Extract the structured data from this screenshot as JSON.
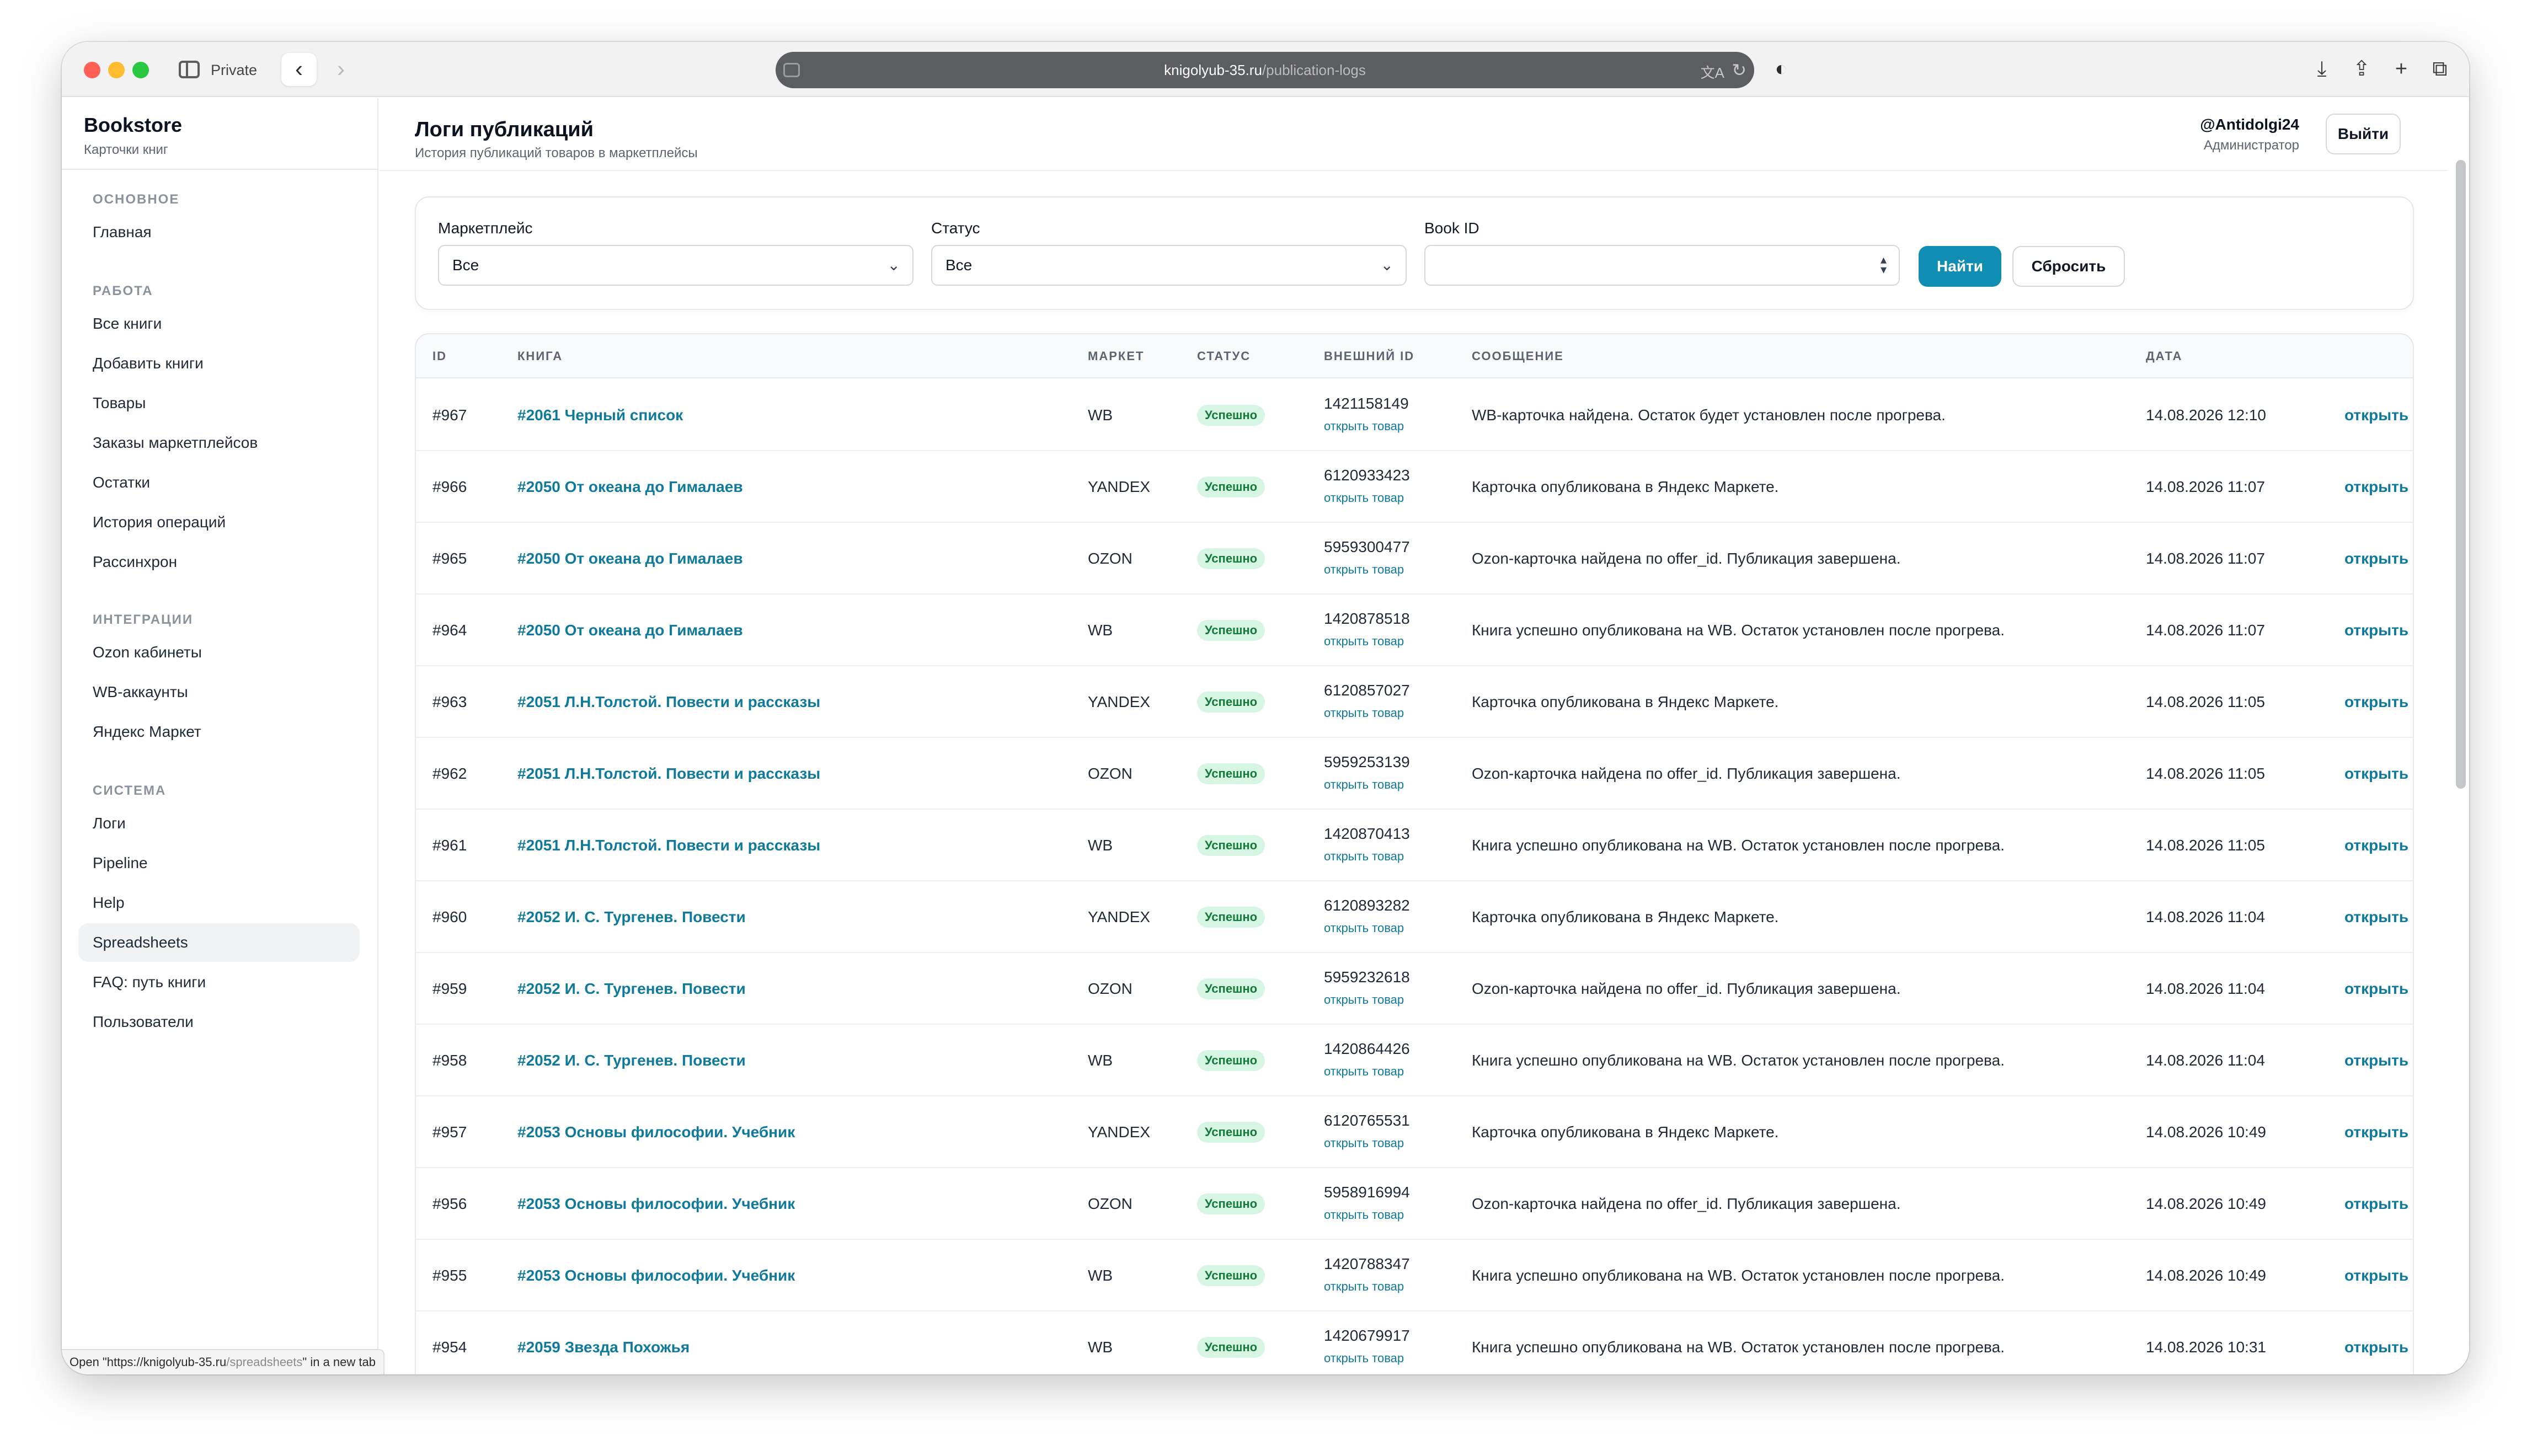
{
  "browser": {
    "private_label": "Private",
    "url_host": "knigolyub-35.ru",
    "url_path": "/publication-logs",
    "status_tip_prefix": "Open \"https://knigolyub-35.ru",
    "status_tip_path": "/spreadsheets",
    "status_tip_suffix": "\" in a new tab"
  },
  "sidebar": {
    "brand": "Bookstore",
    "brand_sub": "Карточки книг",
    "sections": [
      {
        "label": "ОСНОВНОЕ",
        "items": [
          "Главная"
        ]
      },
      {
        "label": "РАБОТА",
        "items": [
          "Все книги",
          "Добавить книги",
          "Товары",
          "Заказы маркетплейсов",
          "Остатки",
          "История операций",
          "Рассинхрон"
        ]
      },
      {
        "label": "ИНТЕГРАЦИИ",
        "items": [
          "Ozon кабинеты",
          "WB-аккаунты",
          "Яндекс Маркет"
        ]
      },
      {
        "label": "СИСТЕМА",
        "items": [
          "Логи",
          "Pipeline",
          "Help",
          "Spreadsheets",
          "FAQ: путь книги",
          "Пользователи"
        ]
      }
    ],
    "active_item": "Spreadsheets"
  },
  "header": {
    "title": "Логи публикаций",
    "subtitle": "История публикаций товаров в маркетплейсы",
    "user": "@Antidolgi24",
    "role": "Администратор",
    "logout": "Выйти"
  },
  "filters": {
    "marketplace_label": "Маркетплейс",
    "marketplace_value": "Все",
    "status_label": "Статус",
    "status_value": "Все",
    "book_id_label": "Book ID",
    "book_id_value": "",
    "find": "Найти",
    "reset": "Сбросить"
  },
  "table": {
    "columns": [
      "ID",
      "КНИГА",
      "МАРКЕТ",
      "СТАТУС",
      "ВНЕШНИЙ ID",
      "СООБЩЕНИЕ",
      "ДАТА"
    ],
    "ext_link_label": "открыть товар",
    "open_label": "открыть",
    "rows": [
      {
        "id": "#967",
        "book": "#2061 Черный список",
        "market": "WB",
        "status": "Успешно",
        "ext_id": "1421158149",
        "message": "WB-карточка найдена. Остаток будет установлен после прогрева.",
        "date": "14.08.2026 12:10"
      },
      {
        "id": "#966",
        "book": "#2050 От океана до Гималаев",
        "market": "YANDEX",
        "status": "Успешно",
        "ext_id": "6120933423",
        "message": "Карточка опубликована в Яндекс Маркете.",
        "date": "14.08.2026 11:07"
      },
      {
        "id": "#965",
        "book": "#2050 От океана до Гималаев",
        "market": "OZON",
        "status": "Успешно",
        "ext_id": "5959300477",
        "message": "Ozon-карточка найдена по offer_id. Публикация завершена.",
        "date": "14.08.2026 11:07"
      },
      {
        "id": "#964",
        "book": "#2050 От океана до Гималаев",
        "market": "WB",
        "status": "Успешно",
        "ext_id": "1420878518",
        "message": "Книга успешно опубликована на WB. Остаток установлен после прогрева.",
        "date": "14.08.2026 11:07"
      },
      {
        "id": "#963",
        "book": "#2051 Л.Н.Толстой. Повести и рассказы",
        "market": "YANDEX",
        "status": "Успешно",
        "ext_id": "6120857027",
        "message": "Карточка опубликована в Яндекс Маркете.",
        "date": "14.08.2026 11:05"
      },
      {
        "id": "#962",
        "book": "#2051 Л.Н.Толстой. Повести и рассказы",
        "market": "OZON",
        "status": "Успешно",
        "ext_id": "5959253139",
        "message": "Ozon-карточка найдена по offer_id. Публикация завершена.",
        "date": "14.08.2026 11:05"
      },
      {
        "id": "#961",
        "book": "#2051 Л.Н.Толстой. Повести и рассказы",
        "market": "WB",
        "status": "Успешно",
        "ext_id": "1420870413",
        "message": "Книга успешно опубликована на WB. Остаток установлен после прогрева.",
        "date": "14.08.2026 11:05"
      },
      {
        "id": "#960",
        "book": "#2052 И. С. Тургенев. Повести",
        "market": "YANDEX",
        "status": "Успешно",
        "ext_id": "6120893282",
        "message": "Карточка опубликована в Яндекс Маркете.",
        "date": "14.08.2026 11:04"
      },
      {
        "id": "#959",
        "book": "#2052 И. С. Тургенев. Повести",
        "market": "OZON",
        "status": "Успешно",
        "ext_id": "5959232618",
        "message": "Ozon-карточка найдена по offer_id. Публикация завершена.",
        "date": "14.08.2026 11:04"
      },
      {
        "id": "#958",
        "book": "#2052 И. С. Тургенев. Повести",
        "market": "WB",
        "status": "Успешно",
        "ext_id": "1420864426",
        "message": "Книга успешно опубликована на WB. Остаток установлен после прогрева.",
        "date": "14.08.2026 11:04"
      },
      {
        "id": "#957",
        "book": "#2053 Основы философии. Учебник",
        "market": "YANDEX",
        "status": "Успешно",
        "ext_id": "6120765531",
        "message": "Карточка опубликована в Яндекс Маркете.",
        "date": "14.08.2026 10:49"
      },
      {
        "id": "#956",
        "book": "#2053 Основы философии. Учебник",
        "market": "OZON",
        "status": "Успешно",
        "ext_id": "5958916994",
        "message": "Ozon-карточка найдена по offer_id. Публикация завершена.",
        "date": "14.08.2026 10:49"
      },
      {
        "id": "#955",
        "book": "#2053 Основы философии. Учебник",
        "market": "WB",
        "status": "Успешно",
        "ext_id": "1420788347",
        "message": "Книга успешно опубликована на WB. Остаток установлен после прогрева.",
        "date": "14.08.2026 10:49"
      },
      {
        "id": "#954",
        "book": "#2059 Звезда Похожья",
        "market": "WB",
        "status": "Успешно",
        "ext_id": "1420679917",
        "message": "Книга успешно опубликована на WB. Остаток установлен после прогрева.",
        "date": "14.08.2026 10:31"
      }
    ]
  }
}
